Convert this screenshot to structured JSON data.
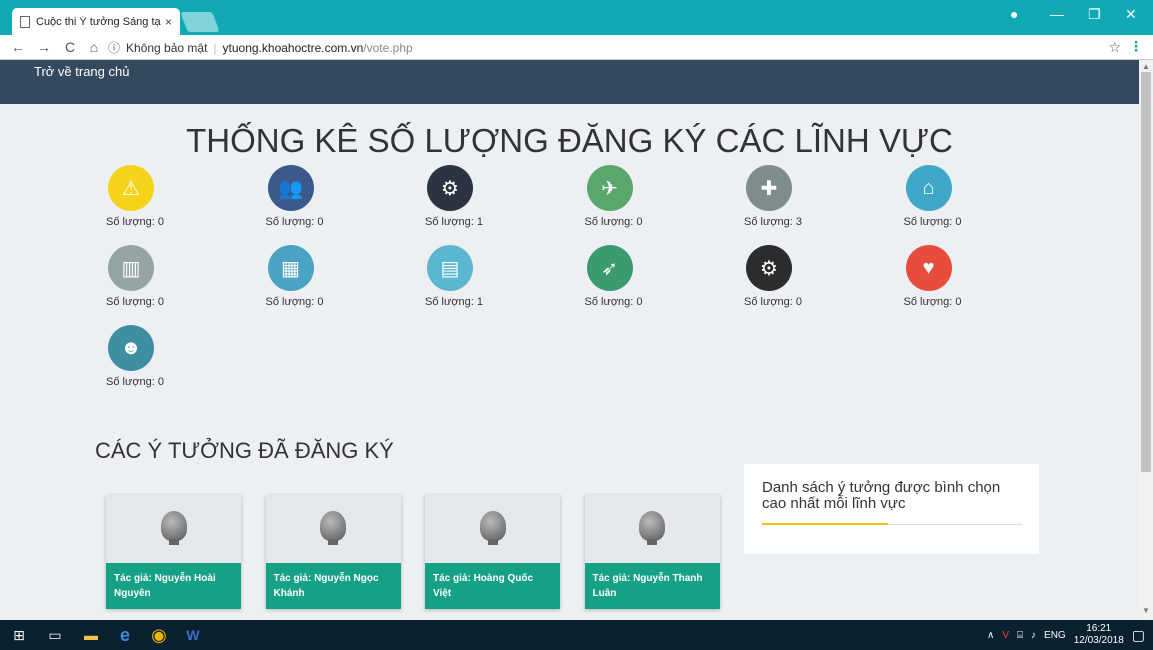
{
  "browser": {
    "tab_title": "Cuộc thi Ý tưởng Sáng tạ",
    "tab_close": "×",
    "security": "Không bảo mật",
    "host": "ytuong.khoahoctre.com.vn",
    "path": "/vote.php",
    "back": "←",
    "forward": "→",
    "reload": "C",
    "home": "⌂",
    "star": "☆",
    "menu": "⋮",
    "minimize": "—",
    "restore": "❐",
    "close": "✕",
    "account": "●"
  },
  "nav": {
    "home_link": "Trở về trang chủ"
  },
  "page": {
    "heading": "THỐNG KÊ SỐ LƯỢNG ĐĂNG KÝ CÁC LĨNH VỰC",
    "section_title": "CÁC Ý TƯỞNG ĐÃ ĐĂNG KÝ",
    "panel_title": "Danh sách ý tưởng được bình chọn cao nhất mỗi lĩnh vực"
  },
  "categories": [
    {
      "label": "Số lượng: 0",
      "icon": "warning-sign-icon",
      "color": "#f5d31b",
      "glyph": "⚠"
    },
    {
      "label": "Số lượng: 0",
      "icon": "people-icon",
      "color": "#3a5a8c",
      "glyph": "👥"
    },
    {
      "label": "Số lượng: 1",
      "icon": "brain-gear-icon",
      "color": "#2b3440",
      "glyph": "⚙"
    },
    {
      "label": "Số lượng: 0",
      "icon": "businessman-icon",
      "color": "#5aa66d",
      "glyph": "✈"
    },
    {
      "label": "Số lượng: 3",
      "icon": "traffic-icon",
      "color": "#7f8c8d",
      "glyph": "✚"
    },
    {
      "label": "Số lượng: 0",
      "icon": "house-flood-icon",
      "color": "#3fa7c9",
      "glyph": "⌂"
    },
    {
      "label": "Số lượng: 0",
      "icon": "factory-icon",
      "color": "#95a5a6",
      "glyph": "▥"
    },
    {
      "label": "Số lượng: 0",
      "icon": "city-tablet-icon",
      "color": "#4aa3c2",
      "glyph": "▦"
    },
    {
      "label": "Số lượng: 1",
      "icon": "buildings-icon",
      "color": "#5bb6cf",
      "glyph": "▤"
    },
    {
      "label": "Số lượng: 0",
      "icon": "rocket-man-icon",
      "color": "#3c9a6f",
      "glyph": "➶"
    },
    {
      "label": "Số lượng: 0",
      "icon": "gears-icon",
      "color": "#2c2c2c",
      "glyph": "⚙"
    },
    {
      "label": "Số lượng: 0",
      "icon": "heart-hands-icon",
      "color": "#e74c3c",
      "glyph": "♥"
    },
    {
      "label": "Số lượng: 0",
      "icon": "idea-man-icon",
      "color": "#3f8fa3",
      "glyph": "☻"
    }
  ],
  "ideas": [
    {
      "author": "Tác giả: Nguyễn Hoài Nguyên"
    },
    {
      "author": "Tác giả: Nguyễn Ngọc Khánh"
    },
    {
      "author": "Tác giả: Hoàng Quốc Việt"
    },
    {
      "author": "Tác giả: Nguyễn Thanh Luân"
    }
  ],
  "taskbar": {
    "language": "ENG",
    "time": "16:21",
    "date": "12/03/2018"
  },
  "colors": {
    "nav_bg": "#34495e",
    "card_footer": "#16a085",
    "accent_bar": "#f1c40f"
  }
}
